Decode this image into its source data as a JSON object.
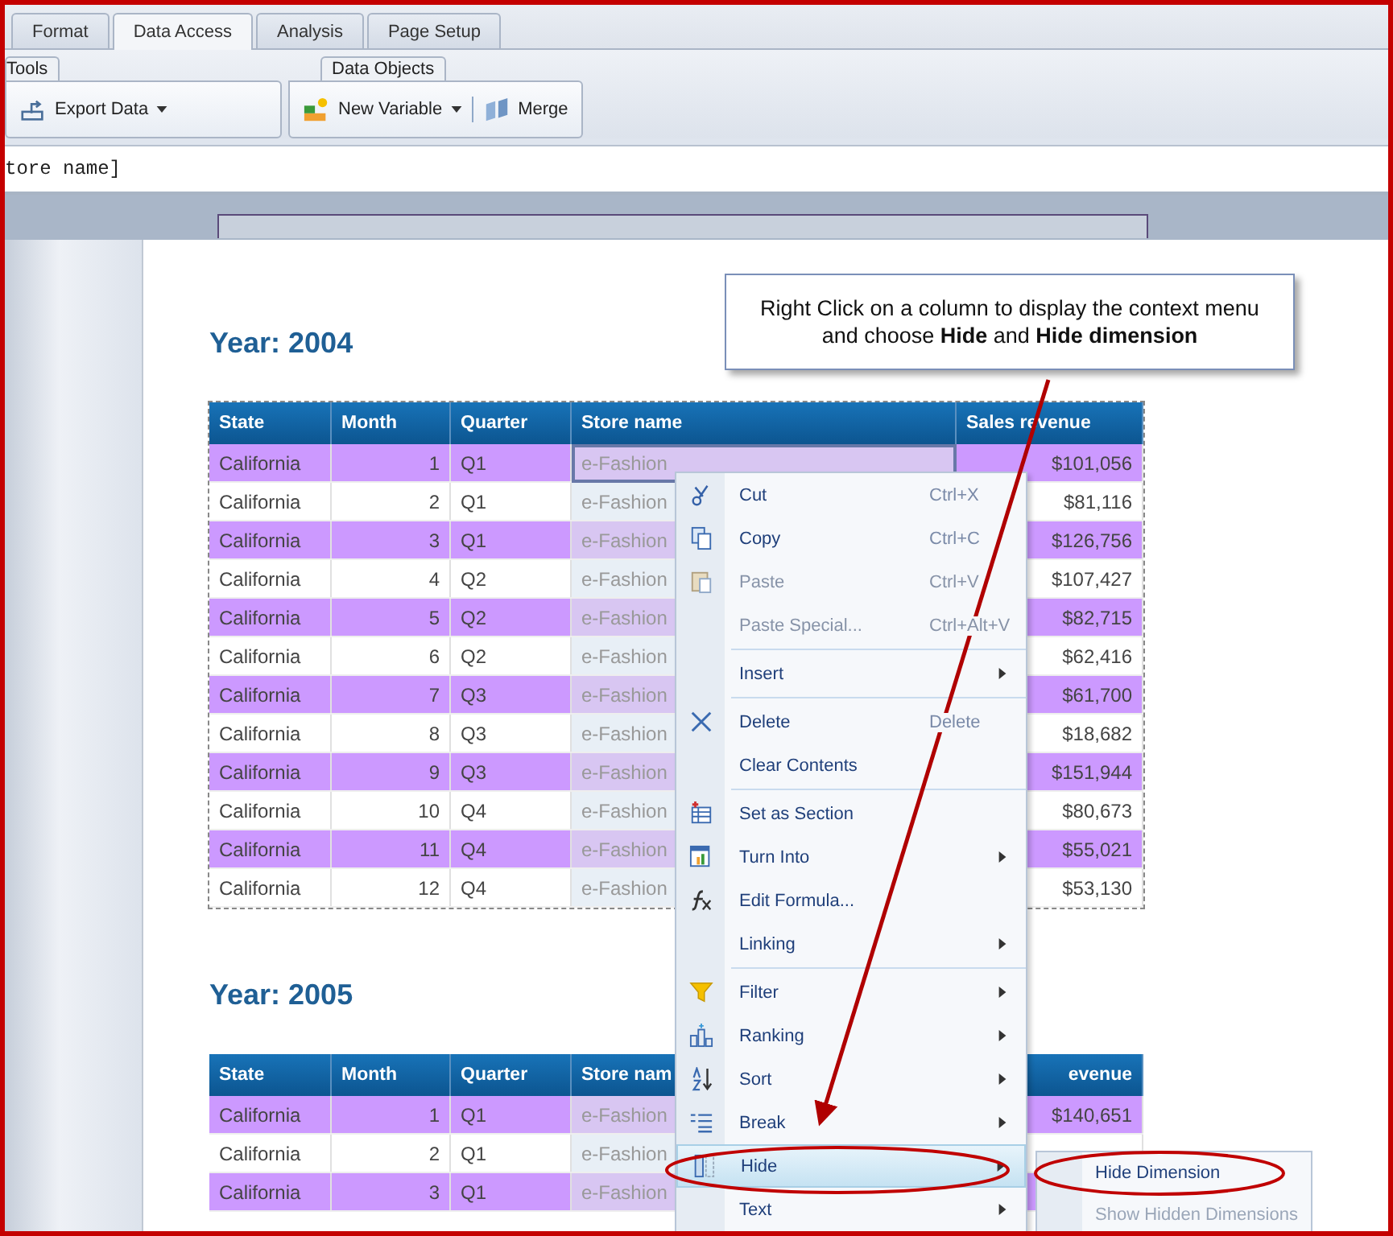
{
  "tabs": [
    {
      "label": "Format",
      "selected": false
    },
    {
      "label": "Data Access",
      "selected": true
    },
    {
      "label": "Analysis",
      "selected": false
    },
    {
      "label": "Page Setup",
      "selected": false
    }
  ],
  "ribbon": {
    "groups": [
      {
        "title": "Tools",
        "buttons": [
          {
            "label": "Export Data",
            "dropdown": true
          }
        ]
      },
      {
        "title": "Data Objects",
        "buttons": [
          {
            "label": "New Variable",
            "dropdown": true
          },
          {
            "label": "Merge",
            "dropdown": false
          }
        ]
      }
    ]
  },
  "formula_bar": {
    "value": "tore name]"
  },
  "sections": [
    {
      "title": "Year: 2004",
      "columns": [
        {
          "label": "State"
        },
        {
          "label": "Month"
        },
        {
          "label": "Quarter"
        },
        {
          "label": "Store name"
        },
        {
          "label": "Sales revenue"
        }
      ],
      "rows": [
        {
          "cells": [
            "California",
            "1",
            "Q1",
            "e-Fashion",
            "$101,056"
          ],
          "selected": true
        },
        {
          "cells": [
            "California",
            "2",
            "Q1",
            "e-Fashion",
            "$81,116"
          ],
          "selected": false
        },
        {
          "cells": [
            "California",
            "3",
            "Q1",
            "e-Fashion",
            "$126,756"
          ],
          "selected": false
        },
        {
          "cells": [
            "California",
            "4",
            "Q2",
            "e-Fashion",
            "$107,427"
          ],
          "selected": false
        },
        {
          "cells": [
            "California",
            "5",
            "Q2",
            "e-Fashion",
            "$82,715"
          ],
          "selected": false
        },
        {
          "cells": [
            "California",
            "6",
            "Q2",
            "e-Fashion",
            "$62,416"
          ],
          "selected": false
        },
        {
          "cells": [
            "California",
            "7",
            "Q3",
            "e-Fashion",
            "$61,700"
          ],
          "selected": false
        },
        {
          "cells": [
            "California",
            "8",
            "Q3",
            "e-Fashion",
            "$18,682"
          ],
          "selected": false
        },
        {
          "cells": [
            "California",
            "9",
            "Q3",
            "e-Fashion",
            "$151,944"
          ],
          "selected": false
        },
        {
          "cells": [
            "California",
            "10",
            "Q4",
            "e-Fashion",
            "$80,673"
          ],
          "selected": false
        },
        {
          "cells": [
            "California",
            "11",
            "Q4",
            "e-Fashion",
            "$55,021"
          ],
          "selected": false
        },
        {
          "cells": [
            "California",
            "12",
            "Q4",
            "e-Fashion",
            "$53,130"
          ],
          "selected": false
        }
      ]
    },
    {
      "title": "Year: 2005",
      "columns": [
        {
          "label": "State"
        },
        {
          "label": "Month"
        },
        {
          "label": "Quarter"
        },
        {
          "label": "Store nam"
        },
        {
          "label": "evenue",
          "header_right": true
        }
      ],
      "rows": [
        {
          "cells": [
            "California",
            "1",
            "Q1",
            "e-Fashion",
            "$140,651"
          ],
          "selected": false
        },
        {
          "cells": [
            "California",
            "2",
            "Q1",
            "e-Fashion"
          ],
          "selected": false
        },
        {
          "cells": [
            "California",
            "3",
            "Q1",
            "e-Fashion"
          ],
          "selected": false
        }
      ]
    }
  ],
  "context_menu": {
    "items": [
      {
        "kind": "item",
        "label": "Cut",
        "shortcut": "Ctrl+X",
        "disabled": false,
        "submenu": false,
        "selected": false
      },
      {
        "kind": "item",
        "label": "Copy",
        "shortcut": "Ctrl+C",
        "disabled": false,
        "submenu": false,
        "selected": false
      },
      {
        "kind": "item",
        "label": "Paste",
        "shortcut": "Ctrl+V",
        "disabled": true,
        "submenu": false,
        "selected": false
      },
      {
        "kind": "item",
        "label": "Paste Special...",
        "shortcut": "Ctrl+Alt+V",
        "disabled": true,
        "submenu": false,
        "selected": false
      },
      {
        "kind": "separator"
      },
      {
        "kind": "item",
        "label": "Insert",
        "disabled": false,
        "submenu": true,
        "selected": false
      },
      {
        "kind": "separator"
      },
      {
        "kind": "item",
        "label": "Delete",
        "shortcut": "Delete",
        "disabled": false,
        "submenu": false,
        "selected": false
      },
      {
        "kind": "item",
        "label": "Clear Contents",
        "disabled": false,
        "submenu": false,
        "selected": false
      },
      {
        "kind": "separator"
      },
      {
        "kind": "item",
        "label": "Set as Section",
        "disabled": false,
        "submenu": false,
        "selected": false
      },
      {
        "kind": "item",
        "label": "Turn Into",
        "disabled": false,
        "submenu": true,
        "selected": false
      },
      {
        "kind": "item",
        "label": "Edit Formula...",
        "disabled": false,
        "submenu": false,
        "selected": false
      },
      {
        "kind": "item",
        "label": "Linking",
        "disabled": false,
        "submenu": true,
        "selected": false
      },
      {
        "kind": "separator"
      },
      {
        "kind": "item",
        "label": "Filter",
        "disabled": false,
        "submenu": true,
        "selected": false
      },
      {
        "kind": "item",
        "label": "Ranking",
        "disabled": false,
        "submenu": true,
        "selected": false
      },
      {
        "kind": "item",
        "label": "Sort",
        "disabled": false,
        "submenu": true,
        "selected": false
      },
      {
        "kind": "item",
        "label": "Break",
        "disabled": false,
        "submenu": true,
        "selected": false
      },
      {
        "kind": "item",
        "label": "Hide",
        "disabled": false,
        "submenu": true,
        "selected": true
      },
      {
        "kind": "item",
        "label": "Text",
        "disabled": false,
        "submenu": true,
        "selected": false
      }
    ]
  },
  "submenu": {
    "items": [
      {
        "label": "Hide Dimension",
        "disabled": false
      },
      {
        "label": "Show Hidden Dimensions",
        "disabled": true
      }
    ]
  },
  "callout": {
    "text": "Right Click on a column to display the context menu and choose **Hide** and **Hide dimension**"
  }
}
